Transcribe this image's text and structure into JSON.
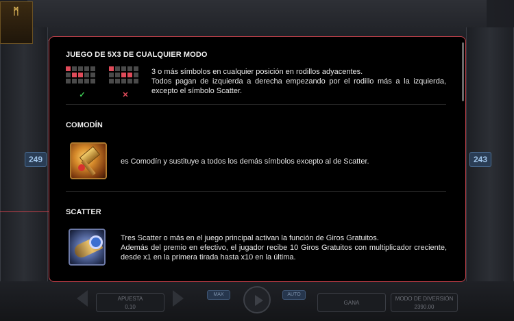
{
  "background": {
    "logo_text_line1": "",
    "side_value_left": "249",
    "side_value_right": "243",
    "bottom": {
      "bet_label": "APUESTA",
      "bet_value": "0.10",
      "win_label": "GANA",
      "balance_label": "MODO DE DIVERSIÓN",
      "balance_value": "2390.00",
      "btn1_label": "MAX",
      "btn2_label": "AUTO"
    }
  },
  "modal": {
    "sections": [
      {
        "title": "JUEGO DE 5X3 DE CUALQUIER MODO",
        "lines": [
          "3 o más símbolos en cualquier posición en rodillos adyacentes.",
          "Todos pagan de izquierda a derecha empezando por el rodillo más a la izquierda, excepto el símbolo Scatter."
        ],
        "example_ok": {
          "mark": "✓",
          "cells": [
            1,
            0,
            0,
            0,
            0,
            0,
            1,
            1,
            0,
            0,
            0,
            0,
            0,
            0,
            0
          ]
        },
        "example_bad": {
          "mark": "✕",
          "cells": [
            1,
            0,
            0,
            0,
            0,
            0,
            0,
            1,
            1,
            0,
            0,
            0,
            0,
            0,
            0
          ]
        }
      },
      {
        "title": "COMODÍN",
        "icon": "hammer-wild-icon",
        "text": "es Comodín y sustituye a todos los demás símbolos excepto al de Scatter."
      },
      {
        "title": "SCATTER",
        "icon": "horn-scatter-icon",
        "lines": [
          "Tres Scatter o más en el juego principal activan la función de Giros Gratuitos.",
          "Además del premio en efectivo, el jugador recibe 10 Giros Gratuitos con multiplicador creciente, desde x1 en la primera tirada hasta x10 en la última."
        ]
      }
    ],
    "colors": {
      "border": "#c8414b",
      "cell_on": "#e04b5a",
      "cell_off": "#4a4a4a",
      "ok": "#3ecf55",
      "no": "#e04b5a"
    }
  }
}
